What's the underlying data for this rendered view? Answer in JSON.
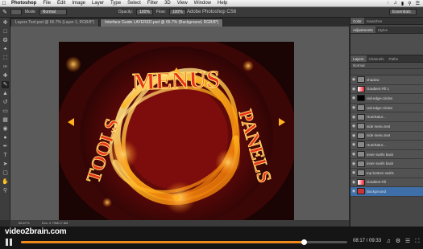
{
  "menubar": {
    "app": "Photoshop",
    "items": [
      "File",
      "Edit",
      "Image",
      "Layer",
      "Type",
      "Select",
      "Filter",
      "3D",
      "View",
      "Window",
      "Help"
    ]
  },
  "options": {
    "mode_label": "Mode:",
    "mode_value": "Normal",
    "opacity_label": "Opacity:",
    "opacity_value": "100%",
    "flow_label": "Flow:",
    "flow_value": "100%",
    "window_title": "Adobe Photoshop CS6",
    "workspace": "Essentials"
  },
  "tabs": [
    {
      "label": "Layers Tool.psd @ 66.7% (Layer 1, RGB/8*)",
      "active": false
    },
    {
      "label": "Interface Guide LAYERED.psd @ 66.7% (Background, RGB/8*)",
      "active": true
    }
  ],
  "artwork": {
    "top_word": "MENUS",
    "left_word": "TOOLS",
    "right_word": "PANELS"
  },
  "status": {
    "zoom": "66.67%",
    "doc": "Doc: 2.79M/17.6M"
  },
  "panels": {
    "top_tabs": [
      "Color",
      "Swatches"
    ],
    "mid_tabs": [
      "Adjustments",
      "Styles"
    ],
    "layer_tabs": [
      "Layers",
      "Channels",
      "Paths"
    ],
    "blend": "Normal",
    "layers": [
      {
        "name": "shadow",
        "kind": "text"
      },
      {
        "name": "Gradient Fill 1",
        "kind": "grad"
      },
      {
        "name": "red-edge-circles",
        "kind": "shape"
      },
      {
        "name": "red-edge-circles",
        "kind": "text"
      },
      {
        "name": "Hue/Satur...",
        "kind": "text"
      },
      {
        "name": "side menu text",
        "kind": "text"
      },
      {
        "name": "side menu text",
        "kind": "text"
      },
      {
        "name": "Hue/Satur...",
        "kind": "text"
      },
      {
        "name": "inner swirls back",
        "kind": "text"
      },
      {
        "name": "inner swirls back",
        "kind": "text"
      },
      {
        "name": "top bottom swirls",
        "kind": "text"
      },
      {
        "name": "Gradient Fill",
        "kind": "grad"
      },
      {
        "name": "Background",
        "kind": "bg",
        "selected": true
      }
    ]
  },
  "player": {
    "logo": "video2brain.com",
    "time": "08:17 / 09:33",
    "progress": 0.866
  },
  "colors": {
    "accent": "#f08a1c",
    "foreground_swatch": "#d63ad6"
  }
}
